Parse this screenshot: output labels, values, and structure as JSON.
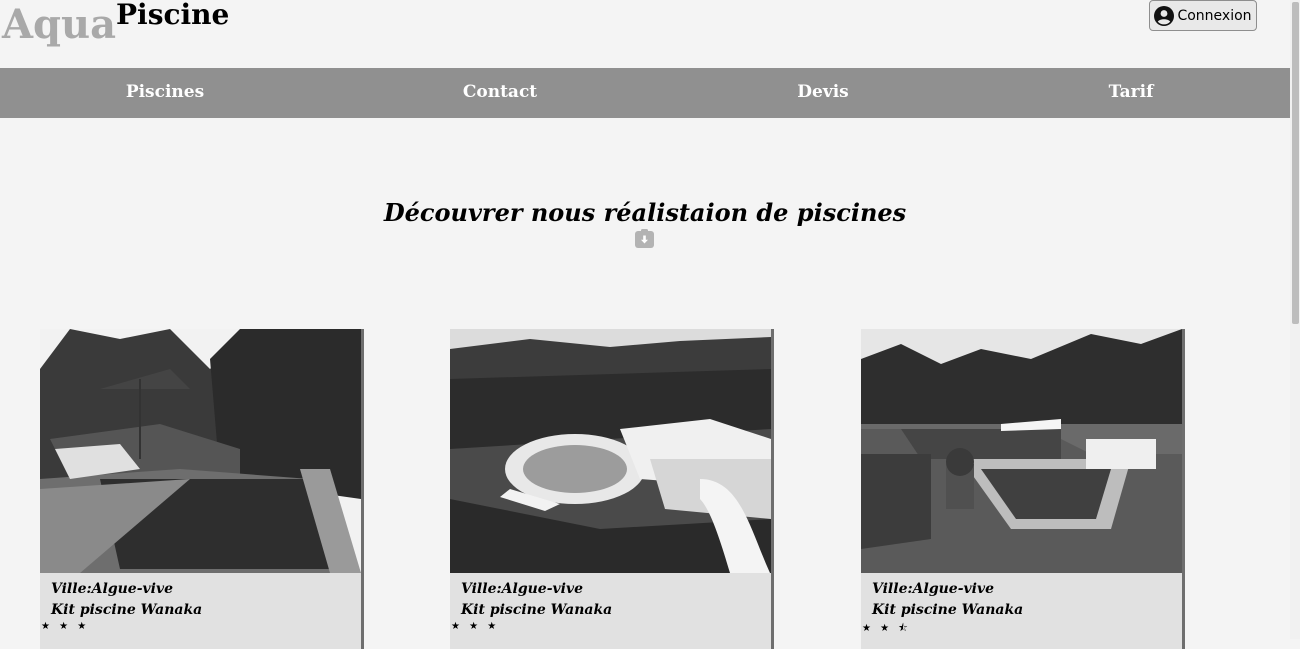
{
  "brand": {
    "part1": "Aqua",
    "part2": "Piscine"
  },
  "login": {
    "label": "Connexion",
    "icon": "user-circle-icon"
  },
  "nav": {
    "items": [
      {
        "label": "Piscines"
      },
      {
        "label": "Contact"
      },
      {
        "label": "Devis"
      },
      {
        "label": "Tarif"
      }
    ]
  },
  "headline": "Découvrer nous réalistaion de piscines",
  "cards": [
    {
      "city": "Ville:Algue-vive",
      "kit": "Kit piscine Wanaka",
      "stars": "★ ★ ★",
      "rating": 3
    },
    {
      "city": "Ville:Algue-vive",
      "kit": "Kit piscine Wanaka",
      "stars": "★ ★ ★",
      "rating": 3
    },
    {
      "city": "Ville:Algue-vive",
      "kit": "Kit piscine Wanaka",
      "stars": "★ ★ ⯪",
      "rating": 2.5
    }
  ],
  "colors": {
    "nav_bg": "#909090",
    "page_bg": "#f4f4f4",
    "card_bg": "#e1e1e1",
    "logo_grey": "#a9a9a9"
  }
}
